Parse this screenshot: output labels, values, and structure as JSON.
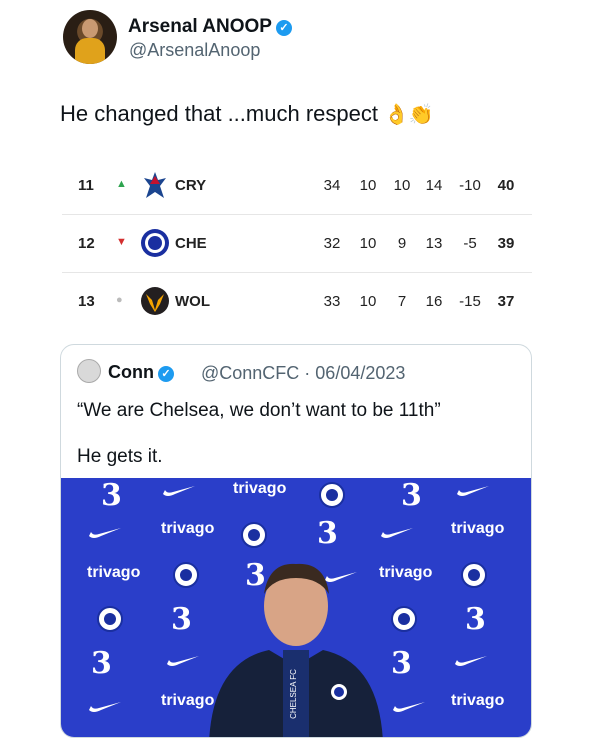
{
  "tweet": {
    "display_name": "Arsenal ANOOP",
    "handle": "@ArsenalAnoop",
    "text": "He changed that ...much respect",
    "emojis": "👌👏",
    "verified_icon": "✓"
  },
  "standings": [
    {
      "pos": "11",
      "trend": "up",
      "trend_icon": "▲",
      "team": "CRY",
      "crest": "palace-crest-icon",
      "p": "34",
      "w": "10",
      "d": "10",
      "l": "14",
      "gd": "-10",
      "pts": "40"
    },
    {
      "pos": "12",
      "trend": "down",
      "trend_icon": "▼",
      "team": "CHE",
      "crest": "chelsea-crest-icon",
      "p": "32",
      "w": "10",
      "d": "9",
      "l": "13",
      "gd": "-5",
      "pts": "39"
    },
    {
      "pos": "13",
      "trend": "same",
      "trend_icon": "●",
      "team": "WOL",
      "crest": "wolves-crest-icon",
      "p": "33",
      "w": "10",
      "d": "7",
      "l": "16",
      "gd": "-15",
      "pts": "37"
    }
  ],
  "quote": {
    "name": "Conn",
    "meta": "@ConnCFC · 06/04/2023",
    "text": "“We are Chelsea, we don’t want to be 11th”",
    "text2": "He gets it.",
    "photo": {
      "sponsor": "trivago",
      "partner": "3",
      "microphone_label": "CHELSEA FC",
      "background": "#2a3ec9"
    }
  },
  "colors": {
    "verified": "#1d9bf0",
    "trend_up": "#2ea44f",
    "trend_down": "#d32f2f",
    "chelsea_blue": "#1a2fa0",
    "wolves_gold": "#f5a300"
  }
}
